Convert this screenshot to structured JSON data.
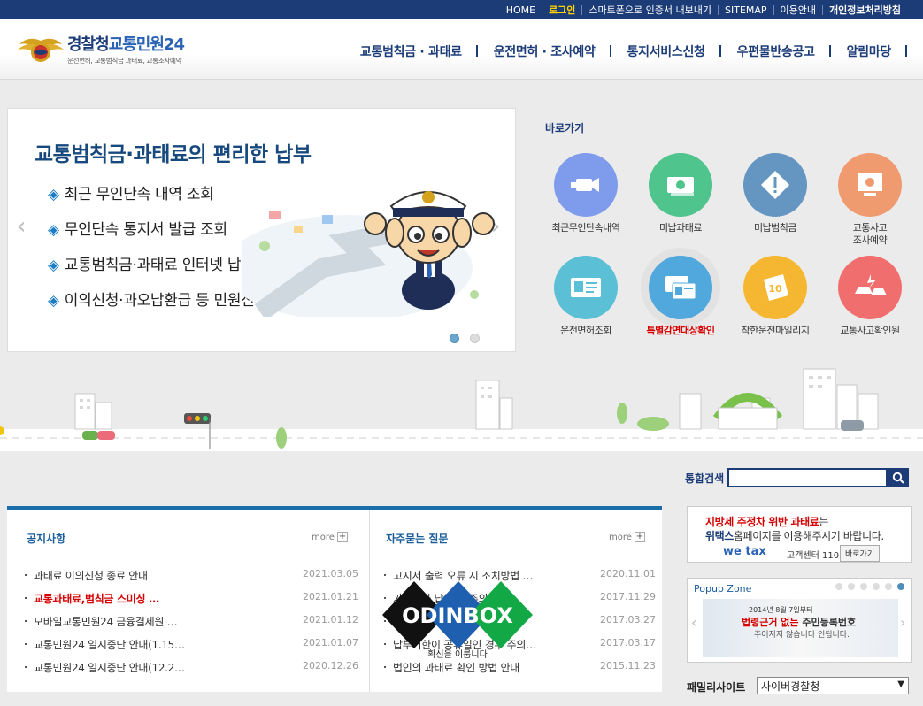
{
  "top_links": [
    {
      "label": "HOME",
      "style": ""
    },
    {
      "label": "로그인",
      "style": "hl"
    },
    {
      "label": "스마트폰으로 인증서 내보내기",
      "style": ""
    },
    {
      "label": "SITEMAP",
      "style": ""
    },
    {
      "label": "이용안내",
      "style": ""
    },
    {
      "label": "개인정보처리방침",
      "style": "b"
    }
  ],
  "logo": {
    "main": "경찰청",
    "accent": "교통민원24",
    "sub": "운전면허, 교통범칙금 과태료, 교통조사예약"
  },
  "gnb": [
    "교통범칙금 · 과태료",
    "운전면허 · 조사예약",
    "통지서비스신청",
    "우편물반송공고",
    "알림마당"
  ],
  "banner": {
    "title": "교통범칙금·과태료의 편리한 납부",
    "items": [
      "최근 무인단속 내역 조회",
      "무인단속 통지서 발급 조회",
      "교통범칙금·과태료 인터넷 납부 지원 등",
      "이의신청·과오납환급 등 민원신청"
    ],
    "bullet": "◈",
    "prev": "‹",
    "next": "›"
  },
  "quick": {
    "title": "바로가기",
    "items": [
      {
        "label": "최근무인단속내역",
        "color": "#7f9bec",
        "icon": "camera-icon"
      },
      {
        "label": "미납과태료",
        "color": "#4fc48c",
        "icon": "money-icon"
      },
      {
        "label": "미납범칙금",
        "color": "#6496c1",
        "icon": "warning-icon"
      },
      {
        "label": "교통사고\n조사예약",
        "color": "#f09a6f",
        "icon": "computer-icon"
      },
      {
        "label": "운전면허조회",
        "color": "#5bbfd6",
        "icon": "license-icon"
      },
      {
        "label": "특별감면대상확인",
        "color": "#51a8dd",
        "icon": "id-card-icon",
        "red": true
      },
      {
        "label": "착한운전마일리지",
        "color": "#f5b731",
        "icon": "mileage-icon"
      },
      {
        "label": "교통사고확인원",
        "color": "#f06e6e",
        "icon": "car-crash-icon"
      }
    ]
  },
  "search": {
    "label": "통합검색",
    "value": ""
  },
  "notice": {
    "title": "공지사항",
    "more": "more",
    "items": [
      {
        "text": "과태료 이의신청 종료 안내",
        "date": "2021.03.05",
        "red": false
      },
      {
        "text": "교통과태료,범칙금 스미싱 …",
        "date": "2021.01.21",
        "red": true
      },
      {
        "text": "모바일교통민원24 금융결제원 …",
        "date": "2021.01.12",
        "red": false
      },
      {
        "text": "교통민원24 일시중단 안내(1.15…",
        "date": "2021.01.07",
        "red": false
      },
      {
        "text": "교통민원24 일시중단 안내(12.2…",
        "date": "2020.12.26",
        "red": false
      }
    ]
  },
  "faq": {
    "title": "자주묻는 질문",
    "more": "more",
    "items": [
      {
        "text": "고지서 출력 오류 시 조치방법 …",
        "date": "2020.11.01"
      },
      {
        "text": "가상계좌 납부 시 주의사항",
        "date": "2017.11.29"
      },
      {
        "text": "",
        "date": "2017.03.27"
      },
      {
        "text": "납부기한이 공휴일인 경우 주의…",
        "date": "2017.03.17"
      },
      {
        "text": "법인의 과태료 확인 방법 안내",
        "date": "2015.11.23"
      }
    ]
  },
  "ad": {
    "line1_red": "지방세 주정차 위반 과태료",
    "line1": "는",
    "line2_blue": "위택스",
    "line2": "홈페이지를 이용해주시기 바랍니다.",
    "brand": "we tax",
    "center": "고객센터 110번",
    "button": "바로가기"
  },
  "popup": {
    "title": "Popup Zone",
    "line1": "2014년 8월 7일부터",
    "line2_red": "법령근거 없는",
    "line2": " 주민등록번호",
    "line3": "주어지지 않습니다 인됩니다."
  },
  "family": {
    "label": "패밀리사이트",
    "selected": "사이버경찰청"
  },
  "watermark": {
    "text": "ODINBOX",
    "sub": "확신을 이룹니다"
  }
}
